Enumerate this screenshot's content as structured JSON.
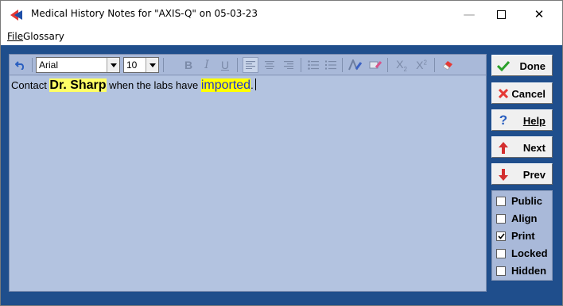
{
  "window": {
    "title": "Medical History Notes for \"AXIS-Q\" on 05-03-23",
    "minimize": "—",
    "close": "✕"
  },
  "menu": {
    "file": "File",
    "glossary": "Glossary"
  },
  "toolbar": {
    "font": "Arial",
    "size": "10",
    "bold": "B",
    "italic": "I",
    "underline": "U",
    "subscript": "X",
    "superscript": "X"
  },
  "editor": {
    "text_before": "Contact ",
    "name": "Dr. Sharp",
    "text_middle": " when the labs have ",
    "highlighted": "imported",
    "text_after": "."
  },
  "buttons": {
    "done": "Done",
    "cancel": "Cancel",
    "help": "Help",
    "next": "Next",
    "prev": "Prev"
  },
  "options": [
    {
      "label": "Public",
      "checked": false
    },
    {
      "label": "Align",
      "checked": false
    },
    {
      "label": "Print",
      "checked": true
    },
    {
      "label": "Locked",
      "checked": false
    },
    {
      "label": "Hidden",
      "checked": false
    }
  ],
  "colors": {
    "frame_blue": "#1f4e8c",
    "editor_bg": "#b3c3e0",
    "highlight": "#ffff00",
    "done_check": "#2aa02a",
    "cancel_x": "#e53935",
    "arrow_red": "#d32f2f"
  }
}
